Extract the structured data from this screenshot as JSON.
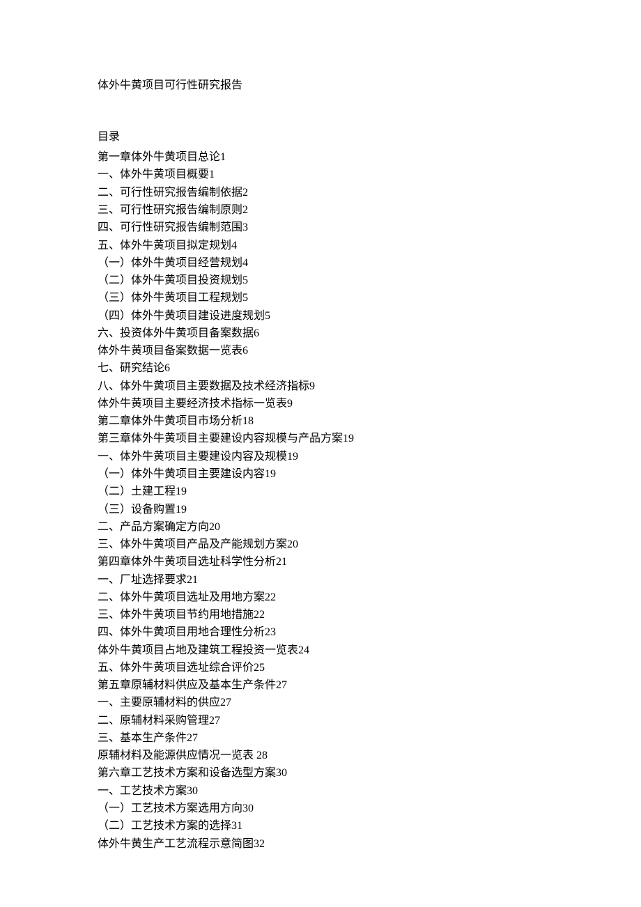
{
  "title": "体外牛黄项目可行性研究报告",
  "toc_heading": "目录",
  "toc": [
    {
      "text": "第一章体外牛黄项目总论",
      "page": "1"
    },
    {
      "text": "一、体外牛黄项目概要",
      "page": "1"
    },
    {
      "text": "二、可行性研究报告编制依据",
      "page": "2"
    },
    {
      "text": "三、可行性研究报告编制原则",
      "page": "2"
    },
    {
      "text": "四、可行性研究报告编制范围",
      "page": "3"
    },
    {
      "text": "五、体外牛黄项目拟定规划",
      "page": "4"
    },
    {
      "text": "（一）体外牛黄项目经营规划",
      "page": "4"
    },
    {
      "text": "（二）体外牛黄项目投资规划",
      "page": "5"
    },
    {
      "text": "（三）体外牛黄项目工程规划",
      "page": "5"
    },
    {
      "text": "（四）体外牛黄项目建设进度规划",
      "page": "5"
    },
    {
      "text": "六、投资体外牛黄项目备案数据",
      "page": "6"
    },
    {
      "text": "体外牛黄项目备案数据一览表",
      "page": "6"
    },
    {
      "text": "七、研究结论",
      "page": "6"
    },
    {
      "text": "八、体外牛黄项目主要数据及技术经济指标",
      "page": "9"
    },
    {
      "text": "体外牛黄项目主要经济技术指标一览表",
      "page": "9"
    },
    {
      "text": "第二章体外牛黄项目市场分析",
      "page": "18"
    },
    {
      "text": "第三章体外牛黄项目主要建设内容规模与产品方案",
      "page": "19"
    },
    {
      "text": "一、体外牛黄项目主要建设内容及规模",
      "page": "19"
    },
    {
      "text": "（一）体外牛黄项目主要建设内容",
      "page": "19"
    },
    {
      "text": "（二）土建工程",
      "page": "19"
    },
    {
      "text": "（三）设备购置",
      "page": "19"
    },
    {
      "text": "二、产品方案确定方向",
      "page": "20"
    },
    {
      "text": "三、体外牛黄项目产品及产能规划方案",
      "page": "20"
    },
    {
      "text": "第四章体外牛黄项目选址科学性分析",
      "page": "21"
    },
    {
      "text": "一、厂址选择要求",
      "page": "21"
    },
    {
      "text": "二、体外牛黄项目选址及用地方案",
      "page": "22"
    },
    {
      "text": "三、体外牛黄项目节约用地措施",
      "page": "22"
    },
    {
      "text": "四、体外牛黄项目用地合理性分析",
      "page": "23"
    },
    {
      "text": "体外牛黄项目占地及建筑工程投资一览表",
      "page": "24"
    },
    {
      "text": "五、体外牛黄项目选址综合评价",
      "page": "25"
    },
    {
      "text": "第五章原辅材料供应及基本生产条件",
      "page": "27"
    },
    {
      "text": "一、主要原辅材料的供应",
      "page": "27"
    },
    {
      "text": "二、原辅材料采购管理",
      "page": "27"
    },
    {
      "text": "三、基本生产条件",
      "page": "27"
    },
    {
      "text": "原辅材料及能源供应情况一览表 ",
      "page": "28"
    },
    {
      "text": "第六章工艺技术方案和设备选型方案",
      "page": "30"
    },
    {
      "text": "一、工艺技术方案",
      "page": "30"
    },
    {
      "text": "（一）工艺技术方案选用方向",
      "page": "30"
    },
    {
      "text": "（二）工艺技术方案的选择",
      "page": "31"
    },
    {
      "text": "体外牛黄生产工艺流程示意简图",
      "page": "32"
    }
  ]
}
